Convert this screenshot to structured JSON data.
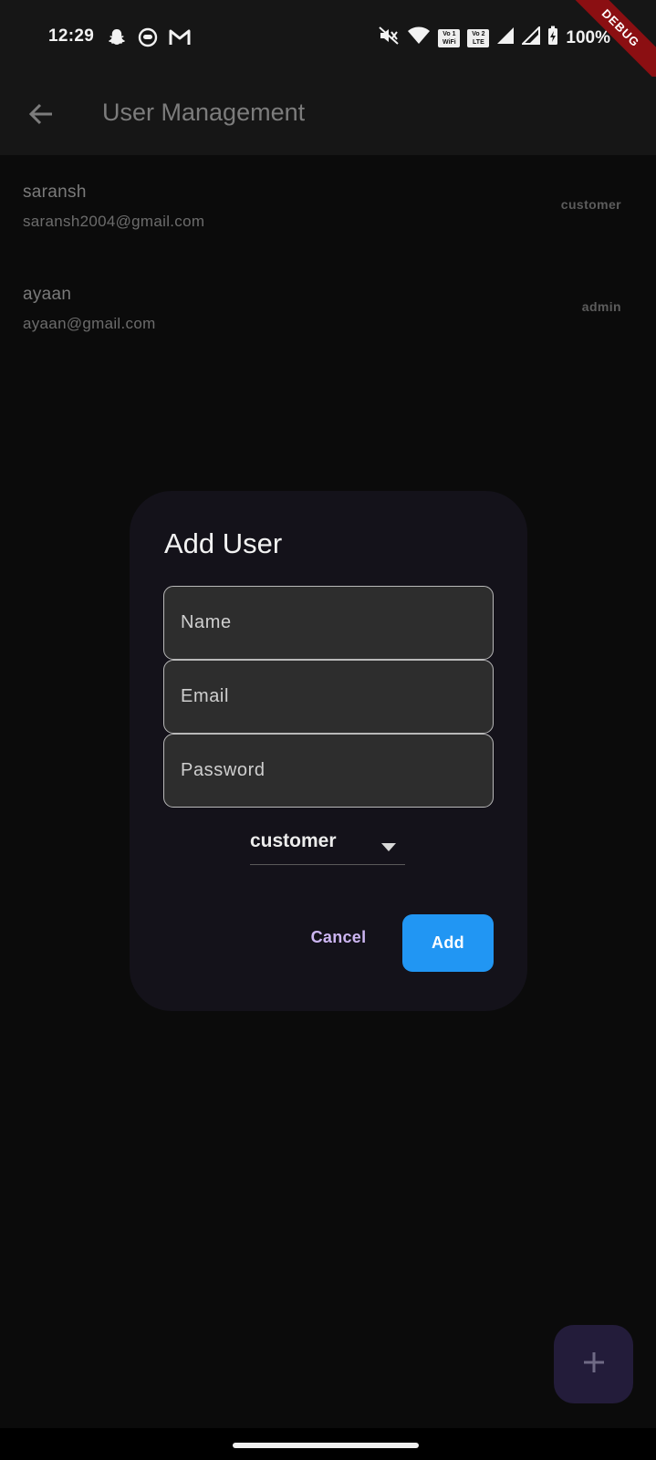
{
  "status_bar": {
    "time": "12:29",
    "left_icons": [
      "snapchat-icon",
      "ghost-app-icon",
      "gmail-icon"
    ],
    "vo_wifi_badge": "Vo 1 WiFi",
    "vo_lte_badge": "Vo 2 LTE",
    "battery_level": "100%",
    "right_icons": [
      "mute-icon",
      "wifi-icon",
      "signal-1-icon",
      "signal-2-icon",
      "battery-charging-icon"
    ]
  },
  "debug_banner": "DEBUG",
  "app_bar": {
    "title": "User Management",
    "back_icon": "arrow-back-icon"
  },
  "users": [
    {
      "name": "saransh",
      "email": "saransh2004@gmail.com",
      "role": "customer"
    },
    {
      "name": "ayaan",
      "email": "ayaan@gmail.com",
      "role": "admin"
    }
  ],
  "dialog": {
    "title": "Add User",
    "name_placeholder": "Name",
    "email_placeholder": "Email",
    "password_placeholder": "Password",
    "role_selected": "customer",
    "cancel_label": "Cancel",
    "add_label": "Add"
  },
  "fab": {
    "icon": "plus-icon"
  },
  "colors": {
    "accent_blue": "#2196f3",
    "cancel_text": "#cdb6f2",
    "dialog_bg": "#14121a",
    "fab_bg": "#231c3a",
    "debug_red": "#8b0f12"
  }
}
